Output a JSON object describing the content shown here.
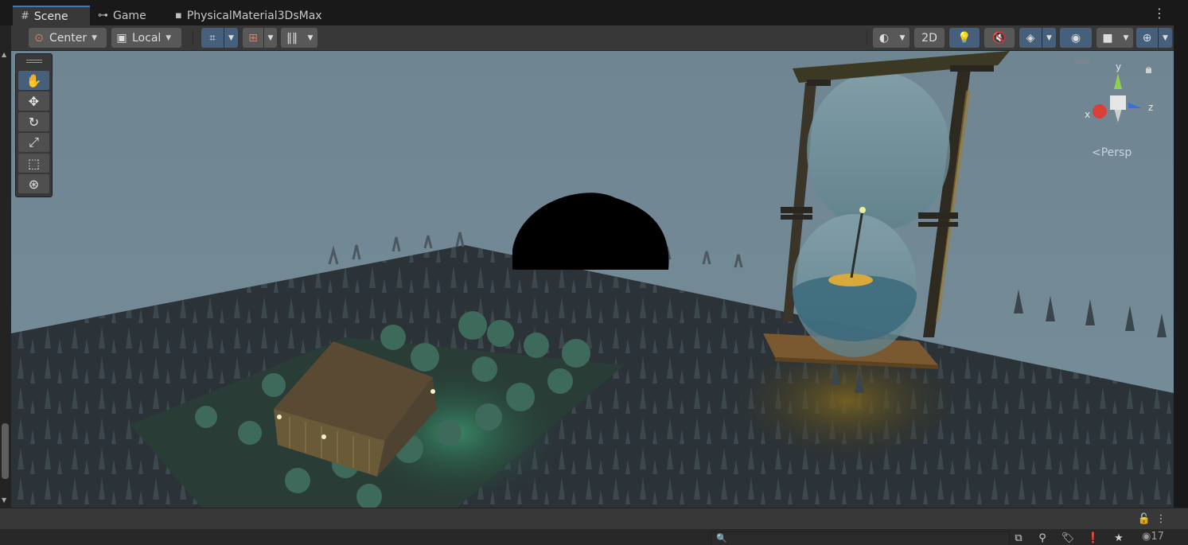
{
  "tabs": [
    {
      "label": "Scene",
      "icon": "grid-hash-icon",
      "active": true
    },
    {
      "label": "Game",
      "icon": "gamepad-icon",
      "active": false
    },
    {
      "label": "PhysicalMaterial3DsMax",
      "icon": "prefab-icon",
      "active": false
    }
  ],
  "toolbar": {
    "pivot_mode": "Center",
    "pivot_rotation": "Local",
    "toggle_2d": "2D"
  },
  "gizmo": {
    "x_label": "x",
    "y_label": "y",
    "z_label": "z",
    "projection": "Persp"
  },
  "status": {
    "search_placeholder": "",
    "hidden_count": "17"
  },
  "colors": {
    "accent_blue": "#3a79bb",
    "active_button": "#46607c",
    "sky": "#6f8794",
    "ground": "#2c3338"
  }
}
